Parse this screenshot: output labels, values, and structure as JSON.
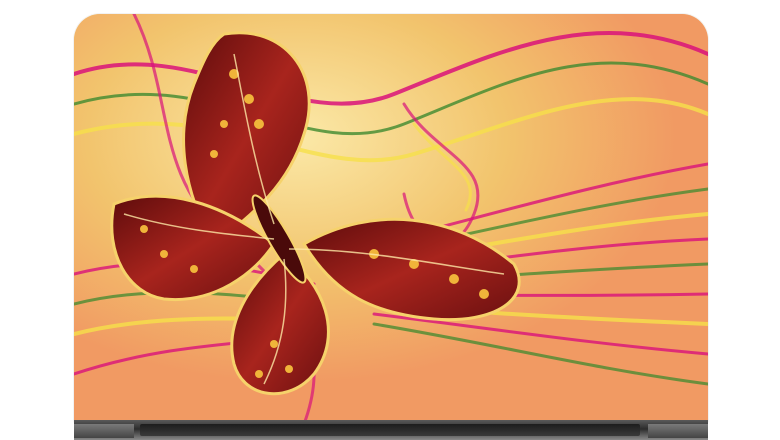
{
  "image": {
    "subject": "laptop-skin",
    "palette": {
      "background": "#ffffff",
      "skin_base": "#f3c36f",
      "magenta_line": "#d9127a",
      "green_line": "#3f8a2f",
      "yellow_line": "#f6e04a",
      "butterfly_red": "#8e1a1a",
      "butterfly_gold": "#f0b43a",
      "hinge_dark": "#2a2a2a"
    }
  }
}
